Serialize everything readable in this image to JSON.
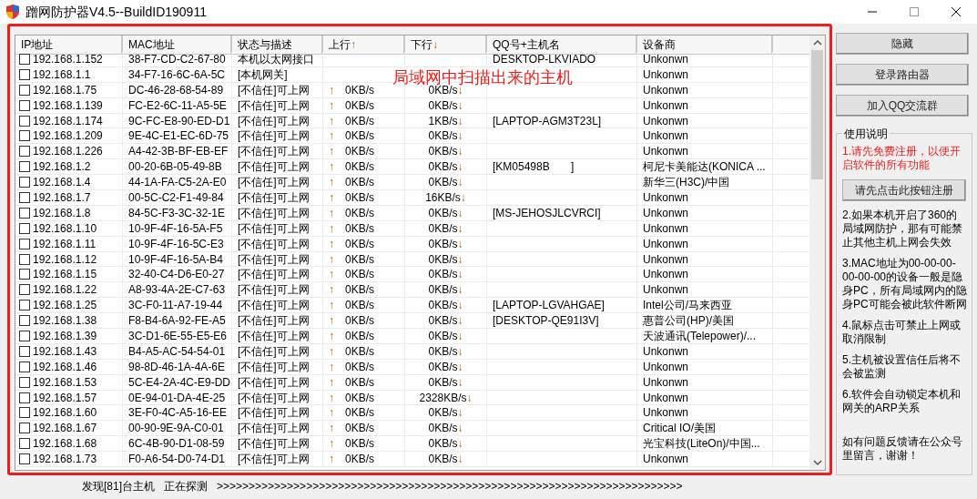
{
  "window": {
    "title": "蹭网防护器V4.5--BuildID190911"
  },
  "annotation": {
    "label": "局域网中扫描出来的主机"
  },
  "table": {
    "columns": [
      {
        "label": "IP地址"
      },
      {
        "label": "MAC地址"
      },
      {
        "label": "状态与描述"
      },
      {
        "label": "上行",
        "arrow": "↑"
      },
      {
        "label": "下行",
        "arrow": "↓"
      },
      {
        "label": "QQ号+主机名"
      },
      {
        "label": "设备商"
      }
    ],
    "rows": [
      {
        "checked": false,
        "ip": "192.168.1.152",
        "mac": "38-F7-CD-C2-67-80",
        "status": "本机以太网接口",
        "host": "DESKTOP-LKVIADO",
        "vendor": "Unkonwn"
      },
      {
        "checked": false,
        "ip": "192.168.1.1",
        "mac": "34-F7-16-6C-6A-5C",
        "status": "[本机网关]",
        "vendor": "Unkonwn"
      },
      {
        "checked": false,
        "ip": "192.168.1.75",
        "mac": "DC-46-28-68-54-89",
        "status": "[不信任]可上网",
        "up_arrow": "↑",
        "up": "0KB/s",
        "down": "0KB/s",
        "down_arrow": "↓",
        "vendor": "Unkonwn"
      },
      {
        "checked": false,
        "ip": "192.168.1.139",
        "mac": "FC-E2-6C-11-A5-5E",
        "status": "[不信任]可上网",
        "up_arrow": "↑",
        "up": "0KB/s",
        "down": "0KB/s",
        "down_arrow": "↓",
        "vendor": "Unkonwn"
      },
      {
        "checked": false,
        "ip": "192.168.1.174",
        "mac": "9C-FC-E8-90-ED-D1",
        "status": "[不信任]可上网",
        "up_arrow": "↑",
        "up": "0KB/s",
        "down": "1KB/s",
        "down_arrow": "↓",
        "host": "[LAPTOP-AGM3T23L]",
        "vendor": "Unkonwn"
      },
      {
        "checked": false,
        "ip": "192.168.1.209",
        "mac": "9E-4C-E1-EC-6D-75",
        "status": "[不信任]可上网",
        "up_arrow": "↑",
        "up": "0KB/s",
        "down": "0KB/s",
        "down_arrow": "↓",
        "vendor": "Unkonwn"
      },
      {
        "checked": false,
        "ip": "192.168.1.226",
        "mac": "A4-42-3B-BF-EB-EF",
        "status": "[不信任]可上网",
        "up_arrow": "↑",
        "up": "0KB/s",
        "down": "0KB/s",
        "down_arrow": "↓",
        "vendor": "Unkonwn"
      },
      {
        "checked": false,
        "ip": "192.168.1.2",
        "mac": "00-20-6B-05-49-8B",
        "status": "[不信任]可上网",
        "up_arrow": "↑",
        "up": "0KB/s",
        "down": "0KB/s",
        "down_arrow": "↓",
        "host": "[KM05498B       ]",
        "vendor": "柯尼卡美能达(KONICA ..."
      },
      {
        "checked": false,
        "ip": "192.168.1.4",
        "mac": "44-1A-FA-C5-2A-E0",
        "status": "[不信任]可上网",
        "up_arrow": "↑",
        "up": "0KB/s",
        "down": "0KB/s",
        "down_arrow": "↓",
        "vendor": "新华三(H3C)/中国"
      },
      {
        "checked": false,
        "ip": "192.168.1.7",
        "mac": "00-5C-C2-F1-49-84",
        "status": "[不信任]可上网",
        "up_arrow": "↑",
        "up": "0KB/s",
        "down": "16KB/s",
        "down_arrow": "↓",
        "vendor": "Unkonwn"
      },
      {
        "checked": false,
        "ip": "192.168.1.8",
        "mac": "84-5C-F3-3C-32-1E",
        "status": "[不信任]可上网",
        "up_arrow": "↑",
        "up": "0KB/s",
        "down": "0KB/s",
        "down_arrow": "↓",
        "host": "[MS-JEHOSJLCVRCI]",
        "vendor": "Unkonwn"
      },
      {
        "checked": false,
        "ip": "192.168.1.10",
        "mac": "10-9F-4F-16-5A-F5",
        "status": "[不信任]可上网",
        "up_arrow": "↑",
        "up": "0KB/s",
        "down": "0KB/s",
        "down_arrow": "↓",
        "vendor": "Unkonwn"
      },
      {
        "checked": false,
        "ip": "192.168.1.11",
        "mac": "10-9F-4F-16-5C-E3",
        "status": "[不信任]可上网",
        "up_arrow": "↑",
        "up": "0KB/s",
        "down": "0KB/s",
        "down_arrow": "↓",
        "vendor": "Unkonwn"
      },
      {
        "checked": false,
        "ip": "192.168.1.12",
        "mac": "10-9F-4F-16-5A-B4",
        "status": "[不信任]可上网",
        "up_arrow": "↑",
        "up": "0KB/s",
        "down": "0KB/s",
        "down_arrow": "↓",
        "vendor": "Unkonwn"
      },
      {
        "checked": false,
        "ip": "192.168.1.15",
        "mac": "32-40-C4-D6-E0-27",
        "status": "[不信任]可上网",
        "up_arrow": "↑",
        "up": "0KB/s",
        "down": "0KB/s",
        "down_arrow": "↓",
        "vendor": "Unkonwn"
      },
      {
        "checked": false,
        "ip": "192.168.1.22",
        "mac": "A8-93-4A-2E-C7-63",
        "status": "[不信任]可上网",
        "up_arrow": "↑",
        "up": "0KB/s",
        "down": "0KB/s",
        "down_arrow": "↓",
        "vendor": "Unkonwn"
      },
      {
        "checked": false,
        "ip": "192.168.1.25",
        "mac": "3C-F0-11-A7-19-44",
        "status": "[不信任]可上网",
        "up_arrow": "↑",
        "up": "0KB/s",
        "down": "0KB/s",
        "down_arrow": "↓",
        "host": "[LAPTOP-LGVAHGAE]",
        "vendor": "Intel公司/马来西亚"
      },
      {
        "checked": false,
        "ip": "192.168.1.38",
        "mac": "F8-B4-6A-92-FE-A5",
        "status": "[不信任]可上网",
        "up_arrow": "↑",
        "up": "0KB/s",
        "down": "0KB/s",
        "down_arrow": "↓",
        "host": "[DESKTOP-QE91I3V]",
        "vendor": "惠普公司(HP)/美国"
      },
      {
        "checked": false,
        "ip": "192.168.1.39",
        "mac": "3C-D1-6E-55-E5-E6",
        "status": "[不信任]可上网",
        "up_arrow": "↑",
        "up": "0KB/s",
        "down": "0KB/s",
        "down_arrow": "↓",
        "vendor": "天波通讯(Telepower)/..."
      },
      {
        "checked": false,
        "ip": "192.168.1.43",
        "mac": "B4-A5-AC-54-54-01",
        "status": "[不信任]可上网",
        "up_arrow": "↑",
        "up": "0KB/s",
        "down": "0KB/s",
        "down_arrow": "↓",
        "vendor": "Unkonwn"
      },
      {
        "checked": false,
        "ip": "192.168.1.46",
        "mac": "98-8D-46-1A-4A-6E",
        "status": "[不信任]可上网",
        "up_arrow": "↑",
        "up": "0KB/s",
        "down": "0KB/s",
        "down_arrow": "↓",
        "vendor": "Unkonwn"
      },
      {
        "checked": false,
        "ip": "192.168.1.53",
        "mac": "5C-E4-2A-4C-E9-DD",
        "status": "[不信任]可上网",
        "up_arrow": "↑",
        "up": "0KB/s",
        "down": "0KB/s",
        "down_arrow": "↓",
        "vendor": "Unkonwn"
      },
      {
        "checked": false,
        "ip": "192.168.1.57",
        "mac": "0E-94-01-DA-4E-25",
        "status": "[不信任]可上网",
        "up_arrow": "↑",
        "up": "0KB/s",
        "down": "2328KB/s",
        "down_arrow": "↓",
        "vendor": "Unkonwn"
      },
      {
        "checked": false,
        "ip": "192.168.1.60",
        "mac": "3E-F0-4C-A5-16-EE",
        "status": "[不信任]可上网",
        "up_arrow": "↑",
        "up": "0KB/s",
        "down": "0KB/s",
        "down_arrow": "↓",
        "vendor": "Unkonwn"
      },
      {
        "checked": false,
        "ip": "192.168.1.67",
        "mac": "00-90-9E-9A-C0-01",
        "status": "[不信任]可上网",
        "up_arrow": "↑",
        "up": "0KB/s",
        "down": "0KB/s",
        "down_arrow": "↓",
        "vendor": "Critical IO/美国"
      },
      {
        "checked": false,
        "ip": "192.168.1.68",
        "mac": "6C-4B-90-D1-08-59",
        "status": "[不信任]可上网",
        "up_arrow": "↑",
        "up": "0KB/s",
        "down": "0KB/s",
        "down_arrow": "↓",
        "vendor": "光宝科技(LiteOn)/中国..."
      },
      {
        "checked": false,
        "ip": "192.168.1.73",
        "mac": "F0-A6-54-D0-74-D1",
        "status": "[不信任]可上网",
        "up_arrow": "↑",
        "up": "0KB/s",
        "down": "0KB/s",
        "down_arrow": "↓",
        "vendor": "Unkonwn"
      }
    ]
  },
  "side_buttons": [
    "隐藏",
    "登录路由器",
    "加入QQ交流群"
  ],
  "help": {
    "title": "使用说明",
    "notes": [
      {
        "kind": "warning",
        "text": "1.请先免费注册，以便开启软件的所有功能"
      },
      {
        "kind": "button",
        "text": "请先点击此按钮注册"
      },
      {
        "kind": "note",
        "text": "2.如果本机开启了360的局域网防护，那有可能禁止其他主机上网会失效"
      },
      {
        "kind": "note",
        "text": "3.MAC地址为00-00-00-00-00-00的设备一般是隐身PC，所有局域网内的隐身PC可能会被此软件断网"
      },
      {
        "kind": "note",
        "text": "4.鼠标点击可禁止上网或取消限制"
      },
      {
        "kind": "note",
        "text": "5.主机被设置信任后将不会被监测"
      },
      {
        "kind": "note",
        "text": "6.软件会自动锁定本机和网关的ARP关系"
      },
      {
        "kind": "footer",
        "text": "如有问题反馈请在公众号里留言，谢谢！"
      }
    ]
  },
  "status_bar": {
    "count": "发现[81]台主机",
    "state": "正在探测",
    "progress": ">>>>>>>>>>>>>>>>>>>>>>>>>>>>>>>>>>>>>>>>>>>>>>>>>>>>>>>>>>>>>>>>>>>>>>>>>"
  }
}
